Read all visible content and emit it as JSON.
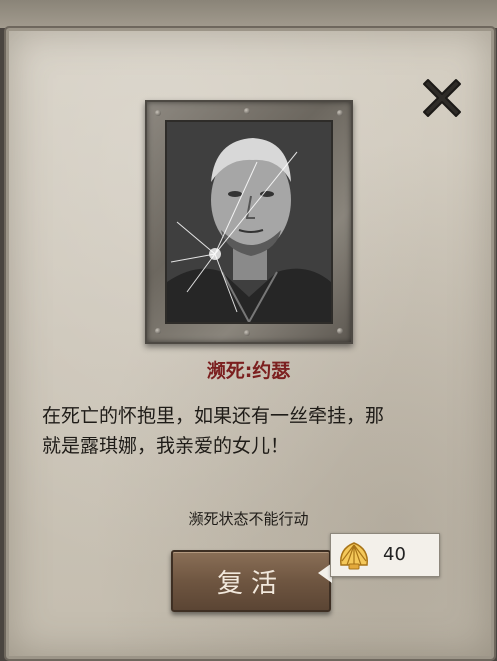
{
  "dialog": {
    "title": "濒死:约瑟",
    "quote_line1": "在死亡的怀抱里，如果还有一丝牵挂，那",
    "quote_line2": "就是露琪娜，我亲爱的女儿！",
    "status": "濒死状态不能行动"
  },
  "revive": {
    "label": "复活",
    "cost": "40",
    "cost_icon": "shell-icon"
  },
  "close_icon": "close-icon",
  "colors": {
    "title": "#7b1f1f",
    "button": "#6f5641",
    "panel": "#d0c9bc"
  }
}
